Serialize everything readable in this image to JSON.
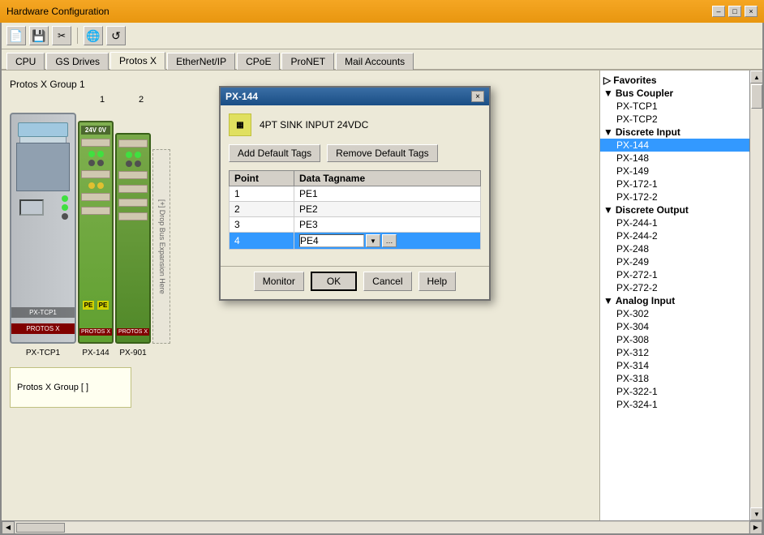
{
  "window": {
    "title": "Hardware Configuration",
    "close_btn": "×",
    "minimize_btn": "–",
    "maximize_btn": "□"
  },
  "toolbar": {
    "buttons": [
      "📄",
      "💾",
      "✂️",
      "🌐",
      "↺"
    ]
  },
  "tabs": [
    {
      "id": "cpu",
      "label": "CPU",
      "active": false
    },
    {
      "id": "gs-drives",
      "label": "GS Drives",
      "active": false
    },
    {
      "id": "protos-x",
      "label": "Protos X",
      "active": true
    },
    {
      "id": "ethernet-ip",
      "label": "EtherNet/IP",
      "active": false
    },
    {
      "id": "cpoe",
      "label": "CPoE",
      "active": false
    },
    {
      "id": "pronet",
      "label": "ProNET",
      "active": false
    },
    {
      "id": "mail-accounts",
      "label": "Mail Accounts",
      "active": false
    }
  ],
  "main": {
    "group_label": "Protos X Group 1",
    "col_labels": [
      "1",
      "2"
    ],
    "expansion_text": "[+] Drop Bus Expansion Here",
    "bottom_labels": [
      "PX-TCP1",
      "",
      "PX-144",
      "PX-901"
    ],
    "group2_label": "Protos X Group [ ]"
  },
  "dialog": {
    "title": "PX-144",
    "item_title": "4PT SINK INPUT 24VDC",
    "add_tags_btn": "Add Default Tags",
    "remove_tags_btn": "Remove Default Tags",
    "table": {
      "headers": [
        "Point",
        "Data Tagname"
      ],
      "rows": [
        {
          "point": "1",
          "tagname": "PE1",
          "selected": false,
          "editable": false
        },
        {
          "point": "2",
          "tagname": "PE2",
          "selected": false,
          "editable": false
        },
        {
          "point": "3",
          "tagname": "PE3",
          "selected": false,
          "editable": false
        },
        {
          "point": "4",
          "tagname": "PE4",
          "selected": true,
          "editable": true
        }
      ]
    },
    "footer_buttons": [
      {
        "id": "monitor",
        "label": "Monitor"
      },
      {
        "id": "ok",
        "label": "OK"
      },
      {
        "id": "cancel",
        "label": "Cancel"
      },
      {
        "id": "help",
        "label": "Help"
      }
    ]
  },
  "tree": {
    "categories": [
      {
        "id": "favorites",
        "label": "Favorites",
        "expanded": true,
        "items": []
      },
      {
        "id": "bus-coupler",
        "label": "Bus Coupler",
        "expanded": true,
        "items": [
          {
            "id": "px-tcp1",
            "label": "PX-TCP1",
            "selected": false
          },
          {
            "id": "px-tcp2",
            "label": "PX-TCP2",
            "selected": false
          }
        ]
      },
      {
        "id": "discrete-input",
        "label": "Discrete Input",
        "expanded": true,
        "items": [
          {
            "id": "px-144",
            "label": "PX-144",
            "selected": true
          },
          {
            "id": "px-148",
            "label": "PX-148",
            "selected": false
          },
          {
            "id": "px-149",
            "label": "PX-149",
            "selected": false
          },
          {
            "id": "px-172-1",
            "label": "PX-172-1",
            "selected": false
          },
          {
            "id": "px-172-2",
            "label": "PX-172-2",
            "selected": false
          }
        ]
      },
      {
        "id": "discrete-output",
        "label": "Discrete Output",
        "expanded": true,
        "items": [
          {
            "id": "px-244-1",
            "label": "PX-244-1",
            "selected": false
          },
          {
            "id": "px-244-2",
            "label": "PX-244-2",
            "selected": false
          },
          {
            "id": "px-248",
            "label": "PX-248",
            "selected": false
          },
          {
            "id": "px-249",
            "label": "PX-249",
            "selected": false
          },
          {
            "id": "px-272-1",
            "label": "PX-272-1",
            "selected": false
          },
          {
            "id": "px-272-2",
            "label": "PX-272-2",
            "selected": false
          }
        ]
      },
      {
        "id": "analog-input",
        "label": "Analog Input",
        "expanded": true,
        "items": [
          {
            "id": "px-302",
            "label": "PX-302",
            "selected": false
          },
          {
            "id": "px-304",
            "label": "PX-304",
            "selected": false
          },
          {
            "id": "px-308",
            "label": "PX-308",
            "selected": false
          },
          {
            "id": "px-312",
            "label": "PX-312",
            "selected": false
          },
          {
            "id": "px-314",
            "label": "PX-314",
            "selected": false
          },
          {
            "id": "px-318",
            "label": "PX-318",
            "selected": false
          },
          {
            "id": "px-322-1",
            "label": "PX-322-1",
            "selected": false
          },
          {
            "id": "px-324-1",
            "label": "PX-324-1",
            "selected": false
          }
        ]
      }
    ]
  }
}
